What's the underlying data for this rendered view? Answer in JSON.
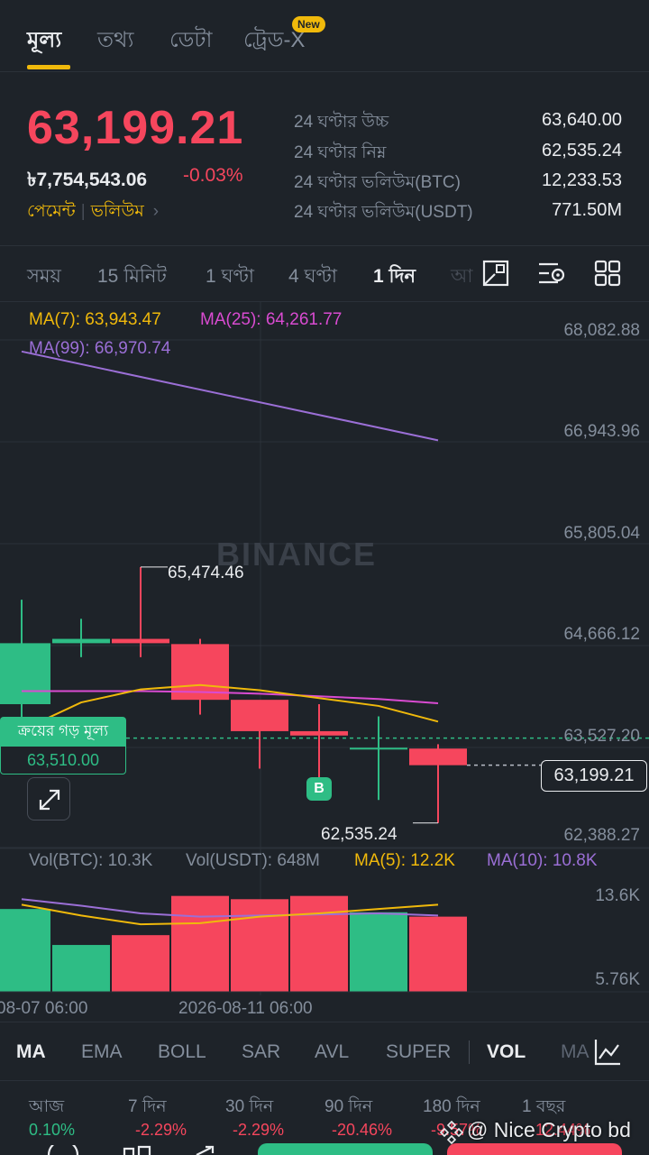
{
  "tabs": [
    {
      "label": "মূল্য",
      "active": true
    },
    {
      "label": "তথ্য"
    },
    {
      "label": "ডেটা"
    },
    {
      "label": "ট্রেড-X"
    }
  ],
  "new_badge": "New",
  "summary": {
    "last_price": "63,199.21",
    "fiat_price": "৳7,754,543.06",
    "change": "-0.03%",
    "tag_payment": "পেমেন্ট",
    "tag_volume": "ভলিউম",
    "stats": [
      {
        "label": "24 ঘণ্টার উচ্চ",
        "value": "63,640.00"
      },
      {
        "label": "24 ঘণ্টার নিম্ন",
        "value": "62,535.24"
      },
      {
        "label": "24 ঘণ্টার ভলিউম(BTC)",
        "value": "12,233.53"
      },
      {
        "label": "24 ঘণ্টার ভলিউম(USDT)",
        "value": "771.50M"
      }
    ]
  },
  "intervals": [
    {
      "label": "সময়"
    },
    {
      "label": "15 মিনিট"
    },
    {
      "label": "1 ঘণ্টা"
    },
    {
      "label": "4 ঘণ্টা"
    },
    {
      "label": "1 দিন",
      "active": true
    },
    {
      "label": "আ"
    }
  ],
  "tool_icons": [
    "drawing-tools-icon",
    "chart-settings-icon",
    "layout-grid-icon"
  ],
  "colors": {
    "up": "#2ebd85",
    "down": "#f6465d",
    "accent": "#f0b90b",
    "ma7": "#f0b90b",
    "ma25": "#d94bd1",
    "ma99": "#9b6fd6"
  },
  "chart_labels": {
    "ma7": "MA(7): 63,943.47",
    "ma25": "MA(25): 64,261.77",
    "ma99": "MA(99): 66,970.74",
    "watermark": "BINANCE",
    "avg_title": "ক্রয়ের গড় মূল্য",
    "avg_value": "63,510.00",
    "high_label": "65,474.46",
    "low_label": "62,535.24",
    "marker": "B",
    "current_tag": "63,199.21",
    "vol_btc": "Vol(BTC): 10.3K",
    "vol_usdt": "Vol(USDT): 648M",
    "vol_ma5": "MA(5): 12.2K",
    "vol_ma10": "MA(10): 10.8K",
    "vol_axis_top": "13.6K",
    "vol_axis_bottom": "5.76K",
    "date_left": "08-07 06:00",
    "date_mid": "2026-08-11 06:00"
  },
  "chart_data": {
    "type": "candlestick",
    "y_ticks": [
      "68,082.88",
      "66,943.96",
      "65,805.04",
      "64,666.12",
      "63,527.20",
      "62,388.27"
    ],
    "ylim": [
      62388.27,
      68082.88
    ],
    "avg_buy_price": 63510.0,
    "current_price": 63199.21,
    "candles": [
      {
        "open": 63900,
        "close": 64600,
        "high": 65100,
        "low": 63500
      },
      {
        "open": 64600,
        "close": 64650,
        "high": 64880,
        "low": 64440
      },
      {
        "open": 64650,
        "close": 64600,
        "high": 65474.46,
        "low": 64440
      },
      {
        "open": 64590,
        "close": 63950,
        "high": 64650,
        "low": 63780
      },
      {
        "open": 63950,
        "close": 63590,
        "high": 63900,
        "low": 63160
      },
      {
        "open": 63590,
        "close": 63540,
        "high": 63900,
        "low": 62900
      },
      {
        "open": 63400,
        "close": 63400,
        "high": 63760,
        "low": 62800
      },
      {
        "open": 63390,
        "close": 63199.21,
        "high": 63440,
        "low": 62535.24
      }
    ],
    "ma7": [
      63600,
      63920,
      64070,
      64120,
      64060,
      63970,
      63880,
      63700
    ],
    "ma25": [
      64050,
      64050,
      64050,
      64040,
      64020,
      63990,
      63960,
      63910
    ],
    "ma99": [
      {
        "i": 0,
        "v": 67950
      },
      {
        "i": 7,
        "v": 66930
      }
    ],
    "volumes": [
      {
        "value": 11600,
        "dir": "up"
      },
      {
        "value": 8300,
        "dir": "up"
      },
      {
        "value": 9200,
        "dir": "down"
      },
      {
        "value": 12800,
        "dir": "down"
      },
      {
        "value": 12500,
        "dir": "down"
      },
      {
        "value": 12800,
        "dir": "down"
      },
      {
        "value": 11300,
        "dir": "up"
      },
      {
        "value": 10900,
        "dir": "down"
      }
    ],
    "vol_ma5": [
      12000,
      11000,
      10200,
      10300,
      10900,
      11200,
      11600,
      12000
    ],
    "vol_ma10": [
      12500,
      11900,
      11200,
      10900,
      11000,
      11100,
      11200,
      11000
    ],
    "vol_axis": [
      5760,
      13600
    ]
  },
  "indicators": [
    {
      "label": "MA",
      "active": true
    },
    {
      "label": "EMA"
    },
    {
      "label": "BOLL"
    },
    {
      "label": "SAR"
    },
    {
      "label": "AVL"
    },
    {
      "label": "SUPER"
    },
    {
      "label": "VOL",
      "active": true
    },
    {
      "label": "MA"
    }
  ],
  "performance": [
    {
      "label": "আজ",
      "value": "0.10%",
      "dir": "up"
    },
    {
      "label": "7 দিন",
      "value": "-2.29%",
      "dir": "down"
    },
    {
      "label": "30 দিন",
      "value": "-2.29%",
      "dir": "down"
    },
    {
      "label": "90 দিন",
      "value": "-20.46%",
      "dir": "down"
    },
    {
      "label": "180 দিন",
      "value": "-9.57%",
      "dir": "down"
    },
    {
      "label": "1 বছর",
      "value": "-12.44%",
      "dir": "down"
    }
  ],
  "credit": "@ Nice Crypto bd"
}
